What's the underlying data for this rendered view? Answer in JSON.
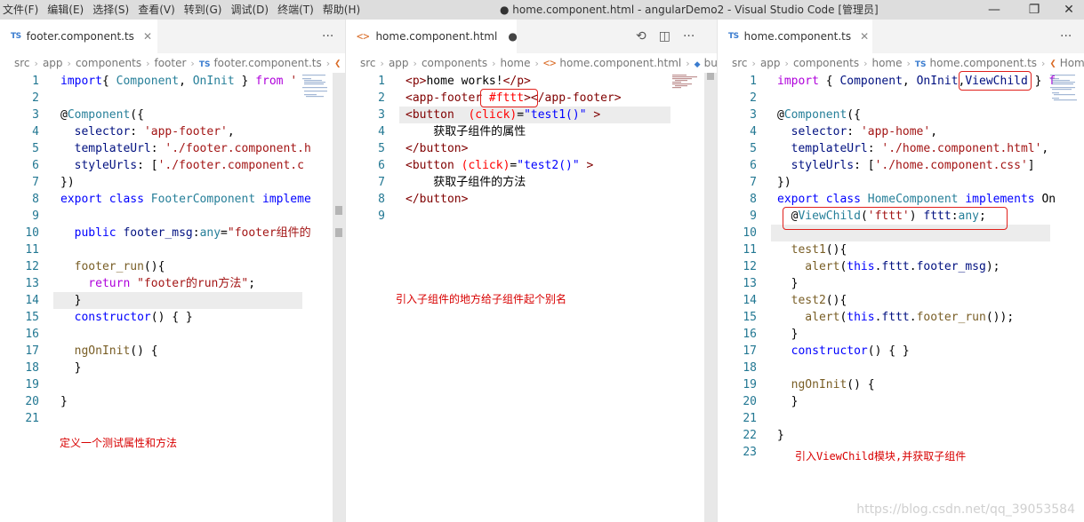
{
  "titlebar": {
    "menus": [
      "文件(F)",
      "编辑(E)",
      "选择(S)",
      "查看(V)",
      "转到(G)",
      "调试(D)",
      "终端(T)",
      "帮助(H)"
    ],
    "title": "● home.component.html - angularDemo2 - Visual Studio Code [管理员]",
    "minimize": "—",
    "maximize": "❐",
    "close": "✕"
  },
  "panes": [
    {
      "tab": {
        "icon": "TS",
        "label": "footer.component.ts",
        "close": "✕"
      },
      "actions": [
        "···"
      ],
      "breadcrumb": [
        "src",
        "app",
        "components",
        "footer",
        "footer.component.ts",
        "❮"
      ],
      "lines": [
        "1",
        "2",
        "3",
        "4",
        "5",
        "6",
        "7",
        "8",
        "9",
        "10",
        "11",
        "12",
        "13",
        "14",
        "15",
        "16",
        "17",
        "18",
        "19",
        "20",
        "21"
      ],
      "annotation": "定义一个测试属性和方法"
    },
    {
      "tab": {
        "icon": "<>",
        "label": "home.component.html",
        "dirty": "●"
      },
      "actions": [
        "⟲",
        "◫",
        "···"
      ],
      "breadcrumb": [
        "src",
        "app",
        "components",
        "home",
        "home.component.html",
        "bu"
      ],
      "lines": [
        "1",
        "2",
        "3",
        "4",
        "5",
        "6",
        "7",
        "8",
        "9"
      ],
      "annotation": "引入子组件的地方给子组件起个别名"
    },
    {
      "tab": {
        "icon": "TS",
        "label": "home.component.ts",
        "close": "✕"
      },
      "actions": [
        "···"
      ],
      "breadcrumb": [
        "src",
        "app",
        "components",
        "home",
        "home.component.ts",
        "Hom"
      ],
      "lines": [
        "1",
        "2",
        "3",
        "4",
        "5",
        "6",
        "7",
        "8",
        "9",
        "10",
        "11",
        "12",
        "13",
        "14",
        "15",
        "16",
        "17",
        "18",
        "19",
        "20",
        "21",
        "22",
        "23"
      ],
      "annotation": "引入ViewChild模块,并获取子组件"
    }
  ],
  "code1": [
    [
      [
        "k",
        "import"
      ],
      [
        "",
        "{ "
      ],
      [
        "t",
        "Component"
      ],
      [
        "",
        ", "
      ],
      [
        "t",
        "OnInit"
      ],
      [
        "",
        " } "
      ],
      [
        "kp",
        "from"
      ],
      [
        "s",
        " '"
      ]
    ],
    [],
    [
      [
        "",
        "@"
      ],
      [
        "t",
        "Component"
      ],
      [
        "",
        "({"
      ]
    ],
    [
      [
        "v",
        "  selector"
      ],
      [
        "",
        ": "
      ],
      [
        "s",
        "'app-footer'"
      ],
      [
        "",
        ","
      ]
    ],
    [
      [
        "v",
        "  templateUrl"
      ],
      [
        "",
        ": "
      ],
      [
        "s",
        "'./footer.component.h"
      ]
    ],
    [
      [
        "v",
        "  styleUrls"
      ],
      [
        "",
        ": ["
      ],
      [
        "s",
        "'./footer.component.c"
      ]
    ],
    [
      [
        "",
        "})"
      ]
    ],
    [
      [
        "k",
        "export"
      ],
      [
        "",
        " "
      ],
      [
        "k",
        "class"
      ],
      [
        "",
        " "
      ],
      [
        "t",
        "FooterComponent"
      ],
      [
        "",
        " "
      ],
      [
        "k",
        "impleme"
      ]
    ],
    [],
    [
      [
        "k",
        "  public"
      ],
      [
        "",
        " "
      ],
      [
        "v",
        "footer_msg"
      ],
      [
        "",
        ":"
      ],
      [
        "t",
        "any"
      ],
      [
        "",
        "="
      ],
      [
        "s",
        "\"footer组件的"
      ]
    ],
    [],
    [
      [
        "f",
        "  footer_run"
      ],
      [
        "",
        "(){"
      ]
    ],
    [
      [
        "kp",
        "    return"
      ],
      [
        "",
        " "
      ],
      [
        "s",
        "\"footer的run方法\""
      ],
      [
        "",
        ";"
      ]
    ],
    [
      [
        "",
        "  }"
      ]
    ],
    [
      [
        "k",
        "  constructor"
      ],
      [
        "",
        "() { }"
      ]
    ],
    [],
    [
      [
        "f",
        "  ngOnInit"
      ],
      [
        "",
        "() {"
      ]
    ],
    [
      [
        "",
        "  }"
      ]
    ],
    [],
    [
      [
        "",
        "}"
      ]
    ],
    []
  ],
  "code2": [
    [
      [
        "tag",
        "<p>"
      ],
      [
        "",
        "home works!"
      ],
      [
        "tag",
        "</p>"
      ]
    ],
    [
      [
        "tag",
        "<app-footer"
      ],
      [
        "at",
        " #fttt"
      ],
      [
        "tag",
        "></app-footer>"
      ]
    ],
    [
      [
        "tag",
        "<button"
      ],
      [
        "at",
        "  (click)"
      ],
      [
        "",
        "="
      ],
      [
        "k",
        "\"test1()\""
      ],
      [
        "tag",
        " >"
      ]
    ],
    [
      [
        "",
        "    获取子组件的属性"
      ]
    ],
    [
      [
        "tag",
        "</button>"
      ]
    ],
    [
      [
        "tag",
        "<button"
      ],
      [
        "at",
        " (click)"
      ],
      [
        "",
        "="
      ],
      [
        "k",
        "\"test2()\""
      ],
      [
        "tag",
        " >"
      ]
    ],
    [
      [
        "",
        "    获取子组件的方法"
      ]
    ],
    [
      [
        "tag",
        "</button>"
      ]
    ],
    []
  ],
  "code3": [
    [
      [
        "kp",
        "import"
      ],
      [
        "",
        " { "
      ],
      [
        "v",
        "Component"
      ],
      [
        "",
        ", "
      ],
      [
        "v",
        "OnInit"
      ],
      [
        "",
        ","
      ],
      [
        "v",
        "ViewChild"
      ],
      [
        "",
        " } "
      ],
      [
        "kp",
        "f"
      ]
    ],
    [],
    [
      [
        "",
        "@"
      ],
      [
        "t",
        "Component"
      ],
      [
        "",
        "({"
      ]
    ],
    [
      [
        "v",
        "  selector"
      ],
      [
        "",
        ": "
      ],
      [
        "s",
        "'app-home'"
      ],
      [
        "",
        ","
      ]
    ],
    [
      [
        "v",
        "  templateUrl"
      ],
      [
        "",
        ": "
      ],
      [
        "s",
        "'./home.component.html'"
      ],
      [
        "",
        ","
      ]
    ],
    [
      [
        "v",
        "  styleUrls"
      ],
      [
        "",
        ": ["
      ],
      [
        "s",
        "'./home.component.css'"
      ],
      [
        "",
        "]"
      ]
    ],
    [
      [
        "",
        "})"
      ]
    ],
    [
      [
        "k",
        "export"
      ],
      [
        "",
        " "
      ],
      [
        "k",
        "class"
      ],
      [
        "",
        " "
      ],
      [
        "t",
        "HomeComponent"
      ],
      [
        "",
        " "
      ],
      [
        "k",
        "implements"
      ],
      [
        "",
        " On"
      ]
    ],
    [
      [
        "",
        "  @"
      ],
      [
        "t",
        "ViewChild"
      ],
      [
        "",
        "("
      ],
      [
        "s",
        "'fttt'"
      ],
      [
        "",
        ") "
      ],
      [
        "v",
        "fttt"
      ],
      [
        "",
        ":"
      ],
      [
        "t",
        "any"
      ],
      [
        "",
        ";"
      ]
    ],
    [],
    [
      [
        "f",
        "  test1"
      ],
      [
        "",
        "(){"
      ]
    ],
    [
      [
        "f",
        "    alert"
      ],
      [
        "",
        "("
      ],
      [
        "k",
        "this"
      ],
      [
        "",
        "."
      ],
      [
        "v",
        "fttt"
      ],
      [
        "",
        "."
      ],
      [
        "v",
        "footer_msg"
      ],
      [
        "",
        ");"
      ]
    ],
    [
      [
        "",
        "  }"
      ]
    ],
    [
      [
        "f",
        "  test2"
      ],
      [
        "",
        "(){"
      ]
    ],
    [
      [
        "f",
        "    alert"
      ],
      [
        "",
        "("
      ],
      [
        "k",
        "this"
      ],
      [
        "",
        "."
      ],
      [
        "v",
        "fttt"
      ],
      [
        "",
        "."
      ],
      [
        "f",
        "footer_run"
      ],
      [
        "",
        "());"
      ]
    ],
    [
      [
        "",
        "  }"
      ]
    ],
    [
      [
        "k",
        "  constructor"
      ],
      [
        "",
        "() { }"
      ]
    ],
    [],
    [
      [
        "f",
        "  ngOnInit"
      ],
      [
        "",
        "() {"
      ]
    ],
    [
      [
        "",
        "  }"
      ]
    ],
    [],
    [
      [
        "",
        "}"
      ]
    ],
    []
  ],
  "watermark": "https://blog.csdn.net/qq_39053584",
  "colors": {
    "annotation": "#d80000",
    "box": "#e0201c",
    "linenum": "#237893"
  }
}
